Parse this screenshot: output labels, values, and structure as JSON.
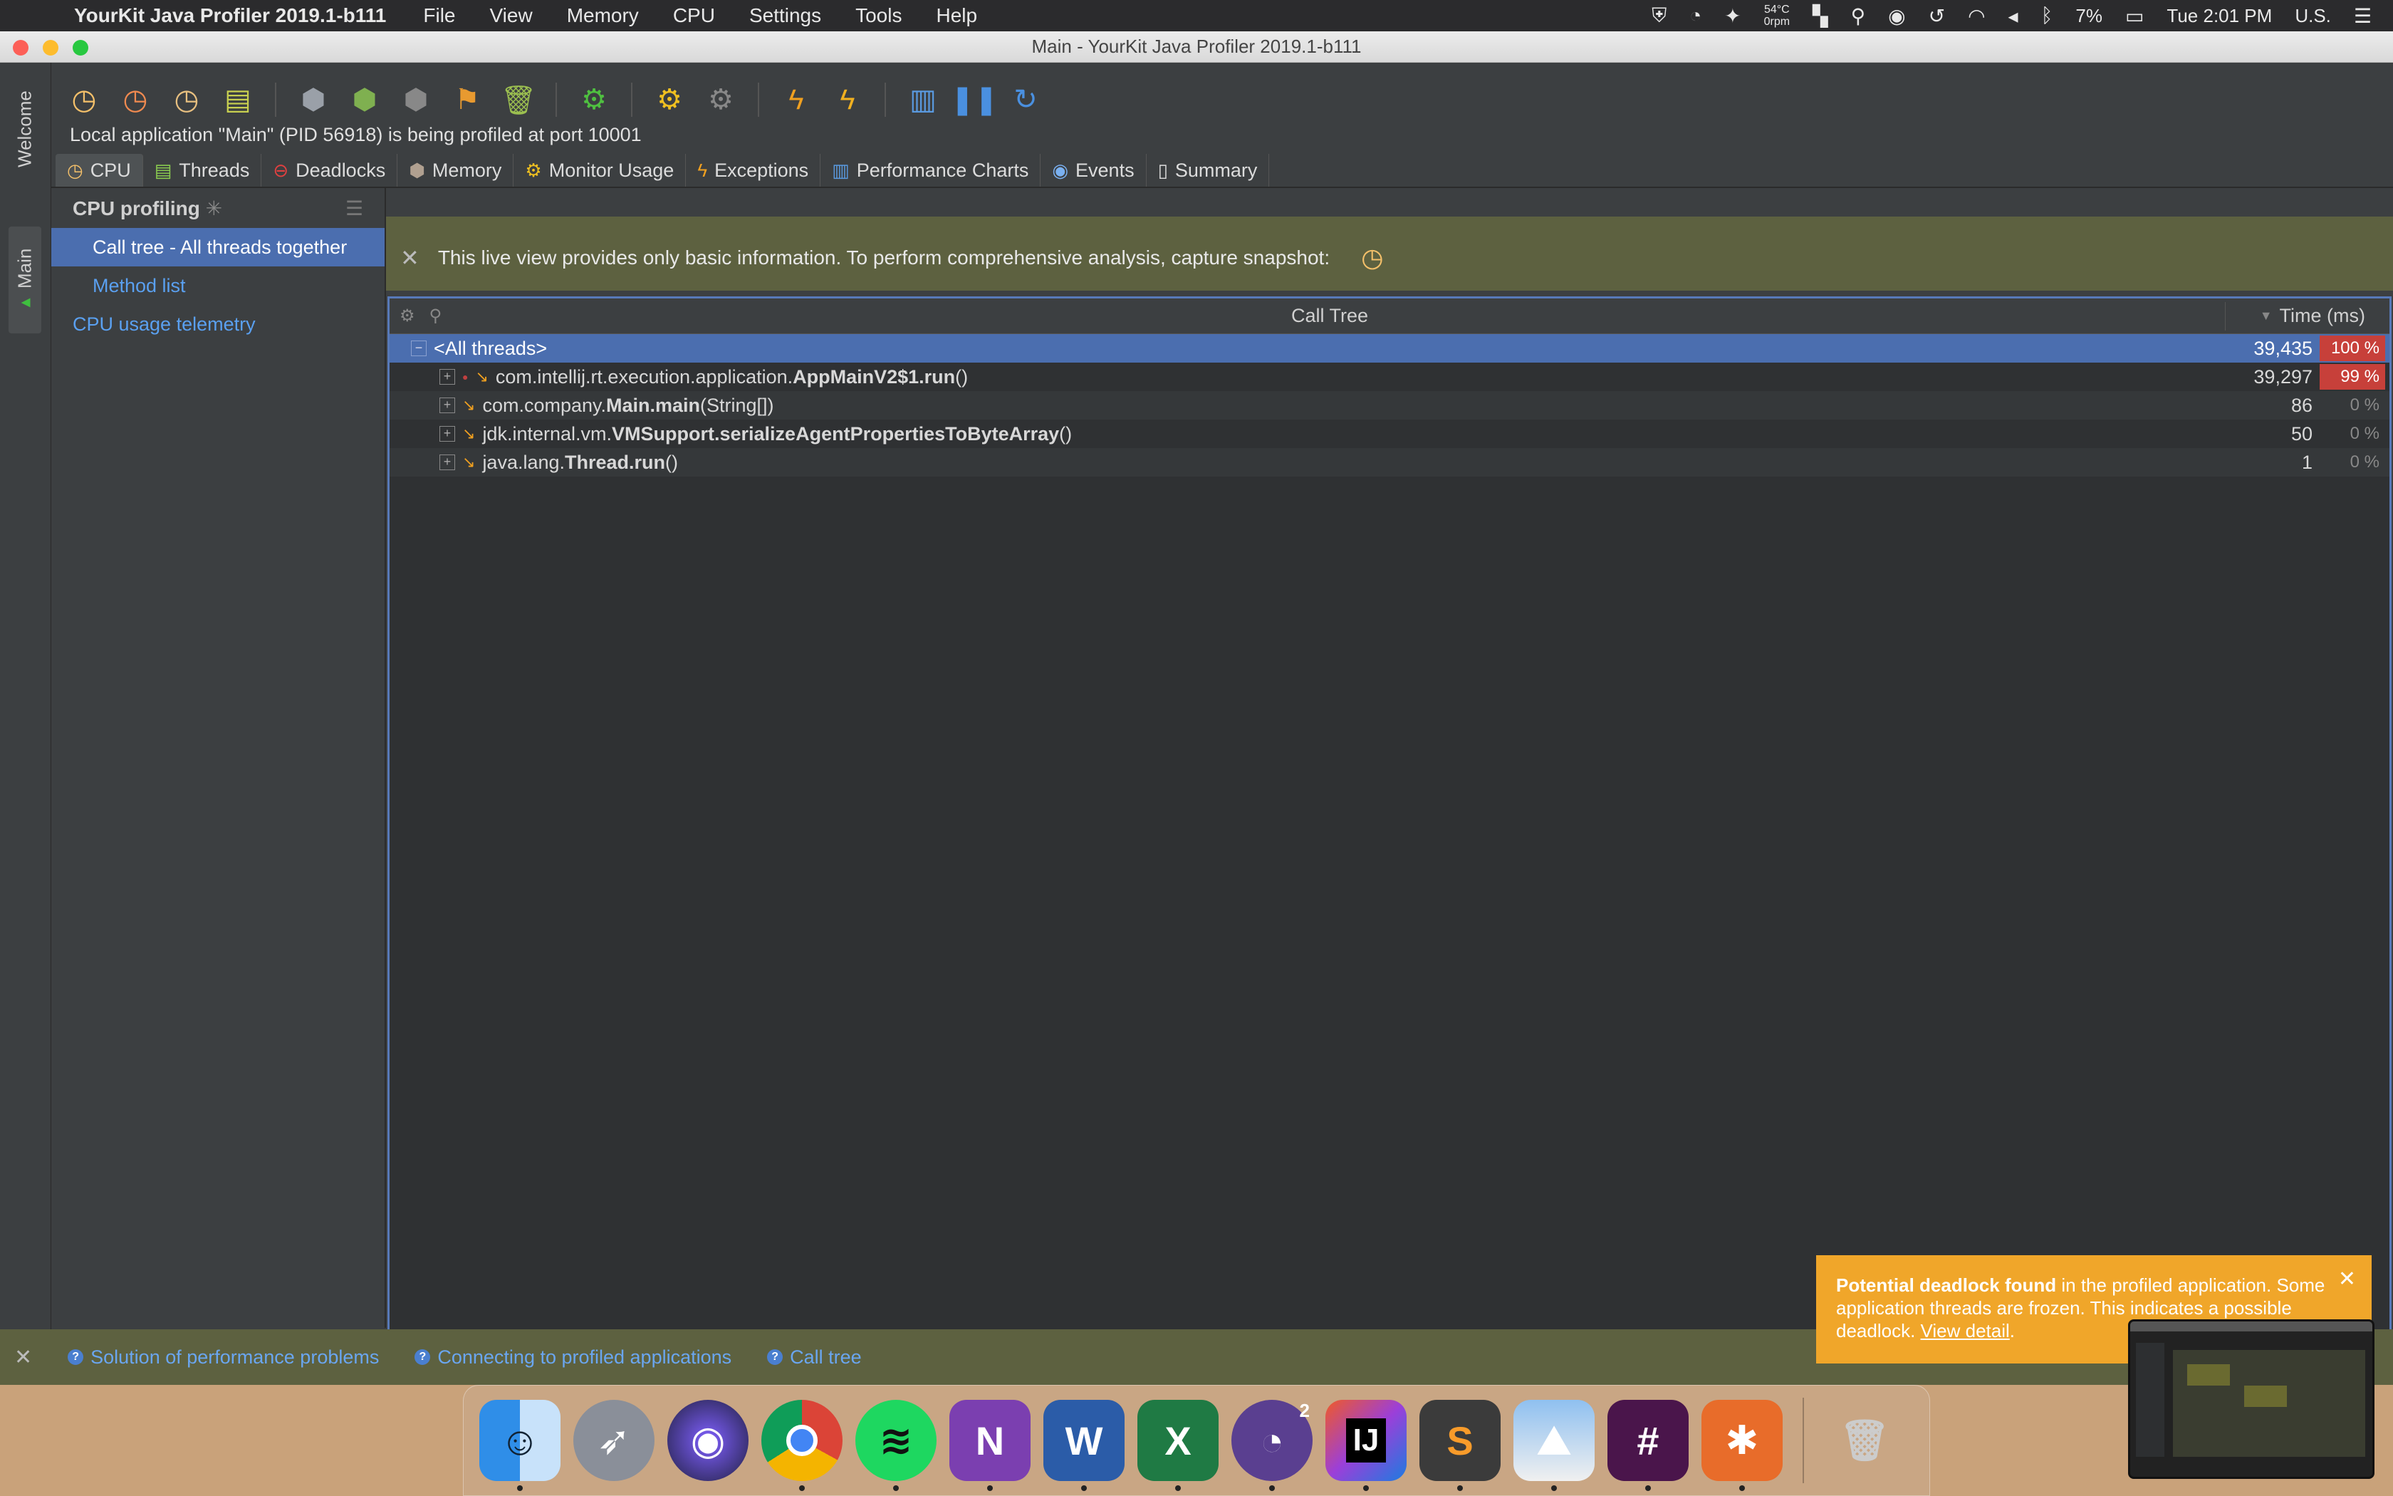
{
  "menubar": {
    "app_name": "YourKit Java Profiler 2019.1-b111",
    "menus": [
      "File",
      "View",
      "Memory",
      "CPU",
      "Settings",
      "Tools",
      "Help"
    ],
    "temp_top": "54°C",
    "temp_bottom": "0rpm",
    "battery": "7%",
    "clock": "Tue 2:01 PM",
    "input_source": "U.S."
  },
  "window": {
    "title": "Main - YourKit Java Profiler 2019.1-b111"
  },
  "side_tabs": {
    "welcome": "Welcome",
    "main": "Main"
  },
  "status_line": "Local application \"Main\" (PID 56918) is being profiled at port 10001",
  "tabs": [
    {
      "label": "CPU",
      "icon": "cpu-icon"
    },
    {
      "label": "Threads",
      "icon": "threads-icon"
    },
    {
      "label": "Deadlocks",
      "icon": "deadlocks-icon"
    },
    {
      "label": "Memory",
      "icon": "memory-icon"
    },
    {
      "label": "Monitor Usage",
      "icon": "monitor-icon"
    },
    {
      "label": "Exceptions",
      "icon": "lightning-icon"
    },
    {
      "label": "Performance Charts",
      "icon": "chart-icon"
    },
    {
      "label": "Events",
      "icon": "eye-icon"
    },
    {
      "label": "Summary",
      "icon": "summary-icon"
    }
  ],
  "nav": {
    "header": "CPU profiling",
    "items": [
      {
        "label": "Call tree - All threads together"
      },
      {
        "label": "Method list"
      },
      {
        "label": "CPU usage telemetry"
      }
    ]
  },
  "banner": {
    "text": "This live view provides only basic information. To perform comprehensive analysis, capture snapshot:"
  },
  "call_tree": {
    "title": "Call Tree",
    "time_header": "Time (ms)",
    "rows": [
      {
        "prefix": "<All threads>",
        "bold": "",
        "suffix": "",
        "time": "39,435",
        "pct": "100 %"
      },
      {
        "prefix": "com.intellij.rt.execution.application.",
        "bold": "AppMainV2$1.run",
        "suffix": "()",
        "time": "39,297",
        "pct": "99 %"
      },
      {
        "prefix": "com.company.",
        "bold": "Main.main",
        "suffix": "(String[])",
        "time": "86",
        "pct": "0 %"
      },
      {
        "prefix": "jdk.internal.vm.",
        "bold": "VMSupport.serializeAgentPropertiesToByteArray",
        "suffix": "()",
        "time": "50",
        "pct": "0 %"
      },
      {
        "prefix": "java.lang.",
        "bold": "Thread.run",
        "suffix": "()",
        "time": "1",
        "pct": "0 %"
      }
    ]
  },
  "helpbar": {
    "links": [
      "Solution of performance problems",
      "Connecting to profiled applications",
      "Call tree"
    ]
  },
  "notification": {
    "bold": "Potential deadlock found",
    "text1": " in the profiled application. Some application threads are frozen. This indicates a possible deadlock. ",
    "link": "View detail",
    "end": "."
  },
  "dock": {
    "apps": [
      "Finder",
      "Launchpad",
      "Siri",
      "Chrome",
      "Spotify",
      "OneNote",
      "Word",
      "Excel",
      "Nightowl",
      "IntelliJ IDEA",
      "Sublime Text",
      "Preview",
      "Slack",
      "YourKit",
      "Trash"
    ],
    "badge": "2"
  },
  "colors": {
    "accent": "#4b6eaf",
    "hot": "#c7403a",
    "banner": "#5d6140",
    "notification": "#f0a62a"
  }
}
